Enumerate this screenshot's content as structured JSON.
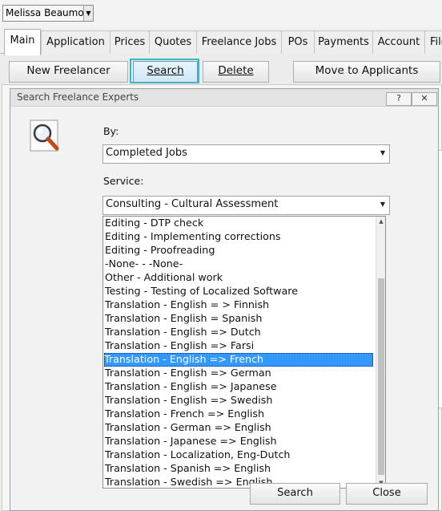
{
  "user": {
    "name": "Melissa Beaumont"
  },
  "tabs": [
    {
      "label": "Main"
    },
    {
      "label": "Application"
    },
    {
      "label": "Prices"
    },
    {
      "label": "Quotes"
    },
    {
      "label": "Freelance Jobs"
    },
    {
      "label": "POs"
    },
    {
      "label": "Payments"
    },
    {
      "label": "Account"
    },
    {
      "label": "File"
    }
  ],
  "toolbar": {
    "new_freelancer": "New Freelancer",
    "search": "Search",
    "delete": "Delete",
    "move_to_applicants": "Move to Applicants"
  },
  "dialog": {
    "title": "Search Freelance Experts",
    "help_label": "?",
    "close_label": "✕",
    "icon": "magnifier-icon",
    "by_label": "By:",
    "by_value": "Completed Jobs",
    "service_label": "Service:",
    "service_value": "Consulting - Cultural Assessment",
    "service_options": [
      "Editing - DTP check",
      "Editing - Implementing corrections",
      "Editing - Proofreading",
      "-None- - -None-",
      "Other - Additional work",
      "Testing - Testing of Localized Software",
      "Translation - English = > Finnish",
      "Translation - English = Spanish",
      "Translation - English => Dutch",
      "Translation - English => Farsi",
      "Translation - English => French",
      "Translation - English => German",
      "Translation - English => Japanese",
      "Translation - English => Swedish",
      "Translation - French => English",
      "Translation - German => English",
      "Translation - Japanese => English",
      "Translation - Localization, Eng-Dutch",
      "Translation - Spanish => English",
      "Translation - Swedish => English"
    ],
    "selected_option": "Translation - English => French",
    "search_button": "Search",
    "close_button": "Close"
  },
  "colors": {
    "focus_ring": "#3fb8b5",
    "selection": "#3399ff"
  }
}
